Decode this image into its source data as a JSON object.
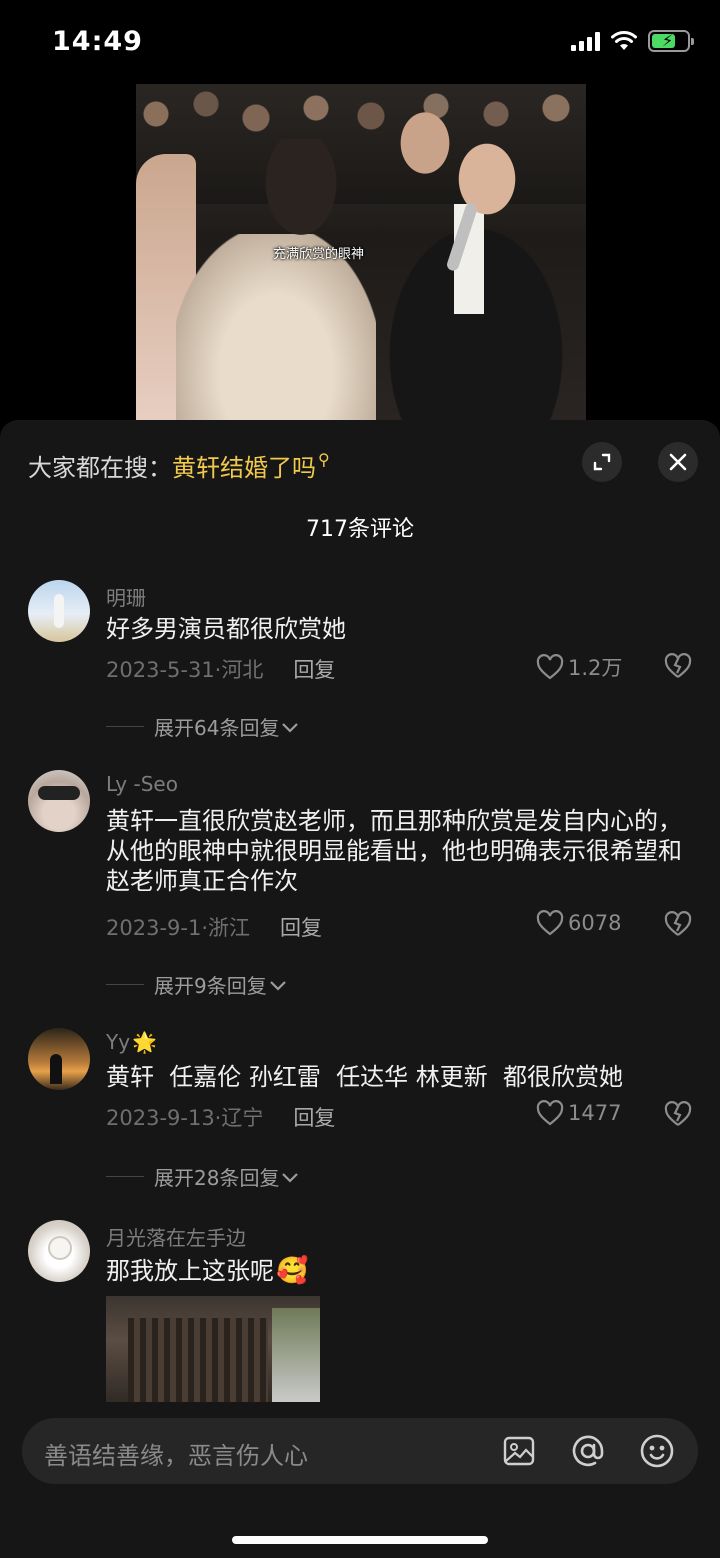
{
  "status_bar": {
    "time": "14:49"
  },
  "video": {
    "caption": "充满欣赏的眼神"
  },
  "search": {
    "prefix": "大家都在搜：",
    "term": "黄轩结婚了吗"
  },
  "comments_header": {
    "count_label": "717条评论"
  },
  "comments": [
    {
      "user": "明珊",
      "text": "好多男演员都很欣赏她",
      "date_location": "2023-5-31·河北",
      "reply_label": "回复",
      "likes": "1.2万",
      "expand_label": "展开64条回复"
    },
    {
      "user": "Ly -Seo",
      "text": "黄轩一直很欣赏赵老师，而且那种欣赏是发自内心的，从他的眼神中就很明显能看出，他也明确表示很希望和赵老师真正合作次",
      "date_location": "2023-9-1·浙江",
      "reply_label": "回复",
      "likes": "6078",
      "expand_label": "展开9条回复"
    },
    {
      "user": "Yy",
      "user_emoji": "🌟",
      "text": "黄轩  任嘉伦 孙红雷  任达华 林更新  都很欣赏她",
      "date_location": "2023-9-13·辽宁",
      "reply_label": "回复",
      "likes": "1477",
      "expand_label": "展开28条回复"
    },
    {
      "user": "月光落在左手边",
      "text": "那我放上这张呢",
      "text_emoji": "🥰"
    }
  ],
  "input": {
    "placeholder": "善语结善缘，恶言伤人心"
  },
  "colors": {
    "accent": "#f1c94c",
    "sheet_bg": "#161616",
    "battery": "#4cd964"
  }
}
